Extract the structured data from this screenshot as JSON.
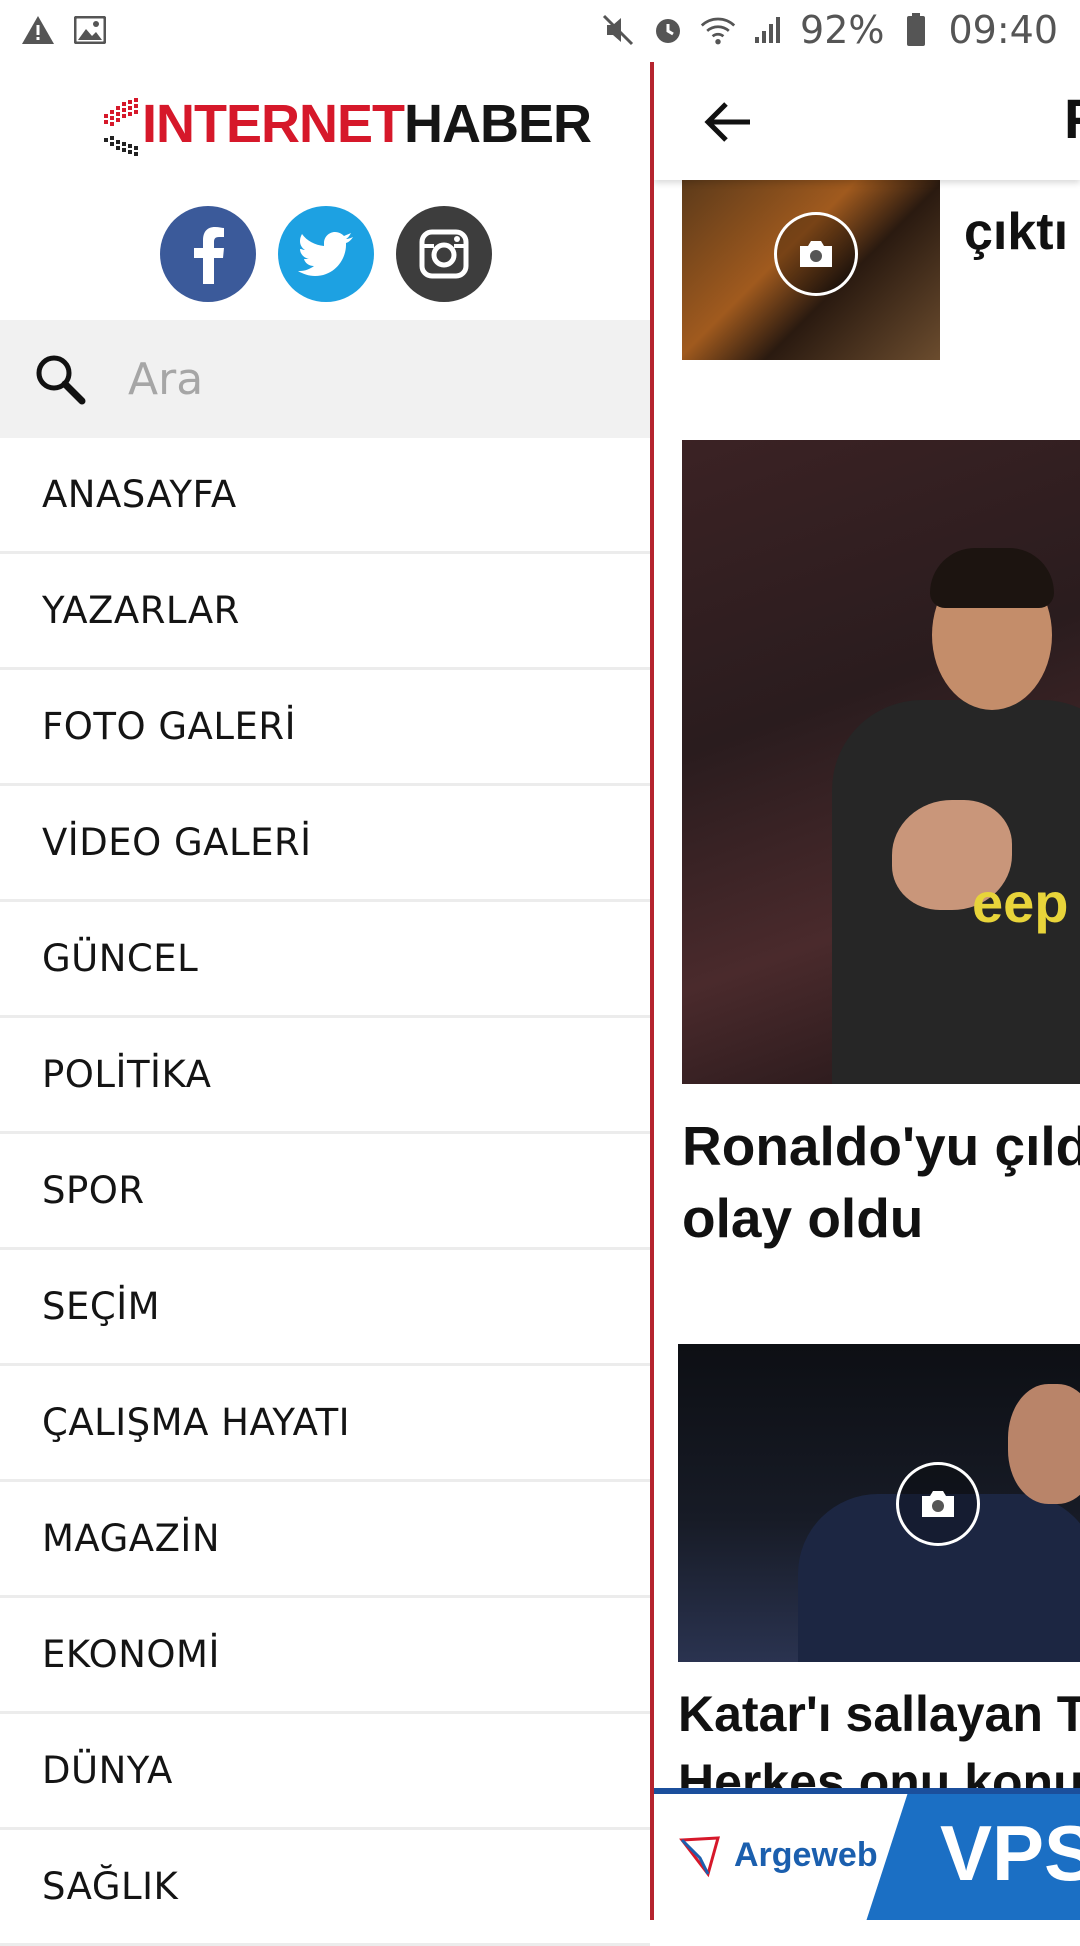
{
  "status_bar": {
    "battery": "92%",
    "time": "09:40",
    "left_icons": [
      "warning-icon",
      "image-icon"
    ],
    "right_icons": [
      "mute-icon",
      "alarm-icon",
      "wifi-icon",
      "signal-icon",
      "battery-icon"
    ]
  },
  "drawer": {
    "logo": {
      "part1": "INTERNET",
      "part2": "HABER",
      "accent": "#d6182a"
    },
    "social": [
      "facebook",
      "twitter",
      "instagram"
    ],
    "search": {
      "placeholder": "Ara"
    },
    "menu": [
      "ANASAYFA",
      "YAZARLAR",
      "FOTO GALERİ",
      "VİDEO GALERİ",
      "GÜNCEL",
      "POLİTİKA",
      "SPOR",
      "SEÇİM",
      "ÇALIŞMA HAYATI",
      "MAGAZİN",
      "EKONOMİ",
      "DÜNYA",
      "SAĞLIK"
    ]
  },
  "content": {
    "topbar_title_fragment": "F",
    "articles": [
      {
        "headline": "çıktı"
      },
      {
        "headline_line1": "Ronaldo'yu çıldı",
        "headline_line2": "olay oldu"
      },
      {
        "headline_line1": "Katar'ı sallayan Tür",
        "headline_line2": "Herkes onu konuşu"
      }
    ],
    "hero_shirt_text": "eep",
    "ad": {
      "brand": "Argeweb",
      "product": "VPS"
    }
  },
  "colors": {
    "divider": "#b5242e",
    "facebook": "#3b5a9a",
    "twitter": "#1da1e2",
    "instagram": "#3d3d3d"
  }
}
